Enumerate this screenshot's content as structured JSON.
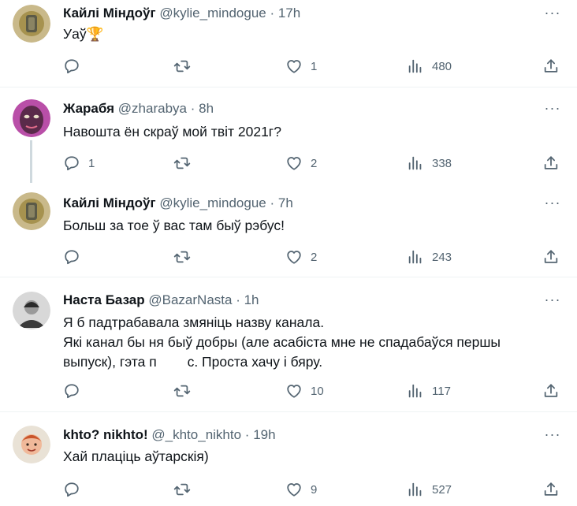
{
  "tweets": [
    {
      "name": "Кайлі Міндоўг",
      "handle": "@kylie_mindogue",
      "time": "17h",
      "text": "Уаў🏆",
      "replies": "",
      "retweets": "",
      "likes": "1",
      "views": "480"
    },
    {
      "name": "Жарабя",
      "handle": "@zharabya",
      "time": "8h",
      "text": "Навошта ён скраў мой твіт 2021г?",
      "replies": "1",
      "retweets": "",
      "likes": "2",
      "views": "338"
    },
    {
      "name": "Кайлі Міндоўг",
      "handle": "@kylie_mindogue",
      "time": "7h",
      "text": "Больш за тое ў вас там быў рэбус!",
      "replies": "",
      "retweets": "",
      "likes": "2",
      "views": "243"
    },
    {
      "name": "Наста Базар",
      "handle": "@BazarNasta",
      "time": "1h",
      "text_lines": [
        "Я б падтрабавала змяніць назву канала.",
        "Які канал бы ня быў добры (але асабіста мне не спадабаўся першы",
        "выпуск), гэта п        с. Проста хачу і бяру."
      ],
      "replies": "",
      "retweets": "",
      "likes": "10",
      "views": "117"
    },
    {
      "name": "khto? nikhto!",
      "handle": "@_khto_nikhto",
      "time": "19h",
      "text": "Хай плаціць аўтарскія)",
      "replies": "",
      "retweets": "",
      "likes": "9",
      "views": "527"
    }
  ],
  "separator": "·",
  "more_glyph": "···",
  "colors": {
    "text_primary": "#0f1419",
    "text_secondary": "#536471",
    "divider": "#eff3f4",
    "thread_line": "#cfd9de"
  },
  "icons": [
    "reply-icon",
    "retweet-icon",
    "like-icon",
    "views-icon",
    "share-icon",
    "more-icon"
  ]
}
